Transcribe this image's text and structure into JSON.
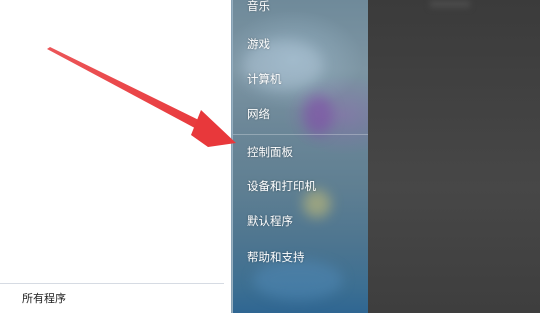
{
  "start_menu": {
    "left_pane": {
      "all_programs_label": "所有程序"
    },
    "right_pane": {
      "items": [
        {
          "label": "音乐"
        },
        {
          "label": "游戏"
        },
        {
          "label": "计算机"
        },
        {
          "label": "网络"
        },
        {
          "label": "控制面板"
        },
        {
          "label": "设备和打印机"
        },
        {
          "label": "默认程序"
        },
        {
          "label": "帮助和支持"
        }
      ]
    }
  },
  "annotation": {
    "arrow_color": "#e8383b"
  },
  "colors": {
    "left_pane_bg": "#ffffff",
    "right_pane_text": "#ffffff",
    "background_dark": "#3a3a3a"
  }
}
